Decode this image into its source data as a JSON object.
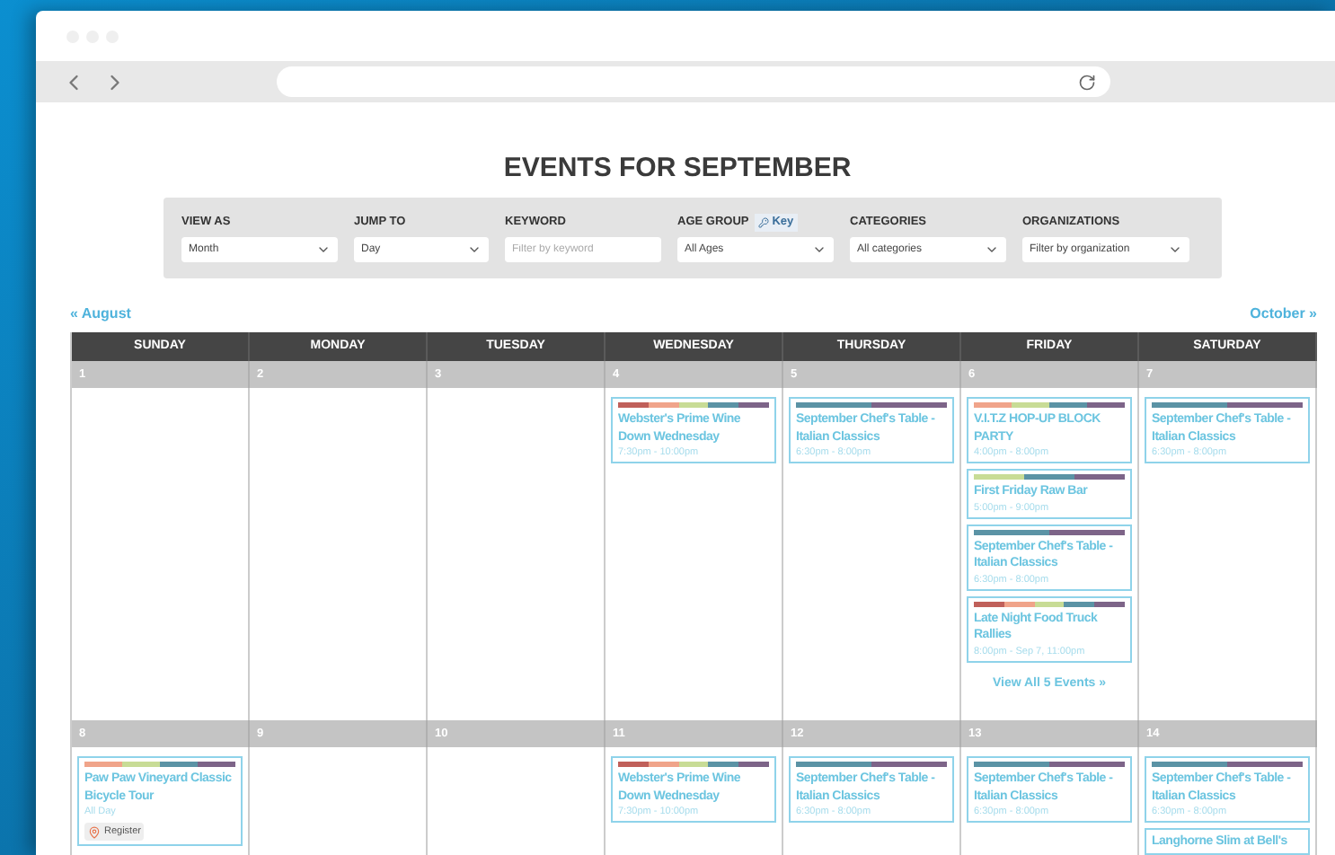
{
  "title": "EVENTS FOR SEPTEMBER",
  "filters": [
    {
      "kind": "select",
      "label": "VIEW AS",
      "value": "Month"
    },
    {
      "kind": "select",
      "label": "JUMP TO",
      "value": "Day"
    },
    {
      "kind": "text",
      "label": "KEYWORD",
      "placeholder": "Filter by keyword"
    },
    {
      "kind": "select",
      "label": "AGE GROUP",
      "key_link": "Key",
      "value": "All Ages"
    },
    {
      "kind": "select",
      "label": "CATEGORIES",
      "value": "All categories"
    },
    {
      "kind": "select",
      "label": "ORGANIZATIONS",
      "value": "Filter by organization"
    }
  ],
  "nav": {
    "prev": "« August",
    "next": "October »"
  },
  "weekdays": [
    "SUNDAY",
    "MONDAY",
    "TUESDAY",
    "WEDNESDAY",
    "THURSDAY",
    "FRIDAY",
    "SATURDAY"
  ],
  "weeks": [
    {
      "days": [
        {
          "date": "1"
        },
        {
          "date": "2"
        },
        {
          "date": "3"
        },
        {
          "date": "4",
          "events": [
            {
              "title": "Webster's Prime Wine Down Wednesday",
              "time": "7:30pm - 10:00pm",
              "stripes": [
                {
                  "color": "#c0605a"
                },
                {
                  "color": "#f0a48a"
                },
                {
                  "color": "#c8dc96"
                },
                {
                  "color": "#5b93a5"
                },
                {
                  "color": "#7d6488"
                }
              ]
            }
          ]
        },
        {
          "date": "5",
          "events": [
            {
              "title": "September Chef's Table - Italian Classics",
              "time": "6:30pm - 8:00pm",
              "stripes": [
                {
                  "color": "#5b93a5"
                },
                {
                  "color": "#7d6488"
                }
              ]
            }
          ]
        },
        {
          "date": "6",
          "events": [
            {
              "title": "V.I.T.Z HOP-UP BLOCK PARTY",
              "time": "4:00pm - 8:00pm",
              "stripes": [
                {
                  "color": "#f0a48a"
                },
                {
                  "color": "#c8dc96"
                },
                {
                  "color": "#5b93a5"
                },
                {
                  "color": "#7d6488"
                }
              ]
            },
            {
              "title": "First Friday Raw Bar",
              "time": "5:00pm - 9:00pm",
              "stripes": [
                {
                  "color": "#c8dc96"
                },
                {
                  "color": "#5b93a5"
                },
                {
                  "color": "#7d6488"
                }
              ]
            },
            {
              "title": "September Chef's Table - Italian Classics",
              "time": "6:30pm - 8:00pm",
              "stripes": [
                {
                  "color": "#5b93a5"
                },
                {
                  "color": "#7d6488"
                }
              ]
            },
            {
              "title": "Late Night Food Truck Rallies",
              "time": "8:00pm - Sep 7, 11:00pm",
              "stripes": [
                {
                  "color": "#c0605a"
                },
                {
                  "color": "#f0a48a"
                },
                {
                  "color": "#c8dc96"
                },
                {
                  "color": "#5b93a5"
                },
                {
                  "color": "#7d6488"
                }
              ]
            }
          ],
          "more": "View All 5 Events »"
        },
        {
          "date": "7",
          "events": [
            {
              "title": "September Chef's Table - Italian Classics",
              "time": "6:30pm - 8:00pm",
              "stripes": [
                {
                  "color": "#5b93a5"
                },
                {
                  "color": "#7d6488"
                }
              ]
            }
          ]
        }
      ]
    },
    {
      "days": [
        {
          "date": "8",
          "events": [
            {
              "title": "Paw Paw Vineyard Classic Bicycle Tour",
              "time": "All Day",
              "register": "Register",
              "stripes": [
                {
                  "color": "#f0a48a"
                },
                {
                  "color": "#c8dc96"
                },
                {
                  "color": "#5b93a5"
                },
                {
                  "color": "#7d6488"
                }
              ]
            }
          ]
        },
        {
          "date": "9"
        },
        {
          "date": "10"
        },
        {
          "date": "11",
          "events": [
            {
              "title": "Webster's Prime Wine Down Wednesday",
              "time": "7:30pm - 10:00pm",
              "stripes": [
                {
                  "color": "#c0605a"
                },
                {
                  "color": "#f0a48a"
                },
                {
                  "color": "#c8dc96"
                },
                {
                  "color": "#5b93a5"
                },
                {
                  "color": "#7d6488"
                }
              ]
            }
          ]
        },
        {
          "date": "12",
          "events": [
            {
              "title": "September Chef's Table - Italian Classics",
              "time": "6:30pm - 8:00pm",
              "stripes": [
                {
                  "color": "#5b93a5"
                },
                {
                  "color": "#7d6488"
                }
              ]
            }
          ]
        },
        {
          "date": "13",
          "events": [
            {
              "title": "September Chef's Table - Italian Classics",
              "time": "6:30pm - 8:00pm",
              "stripes": [
                {
                  "color": "#5b93a5"
                },
                {
                  "color": "#7d6488"
                }
              ]
            }
          ]
        },
        {
          "date": "14",
          "events": [
            {
              "title": "September Chef's Table - Italian Classics",
              "time": "6:30pm - 8:00pm",
              "stripes": [
                {
                  "color": "#5b93a5"
                },
                {
                  "color": "#7d6488"
                }
              ]
            },
            {
              "title": "Langhorne Slim at Bell's"
            }
          ]
        }
      ]
    }
  ]
}
